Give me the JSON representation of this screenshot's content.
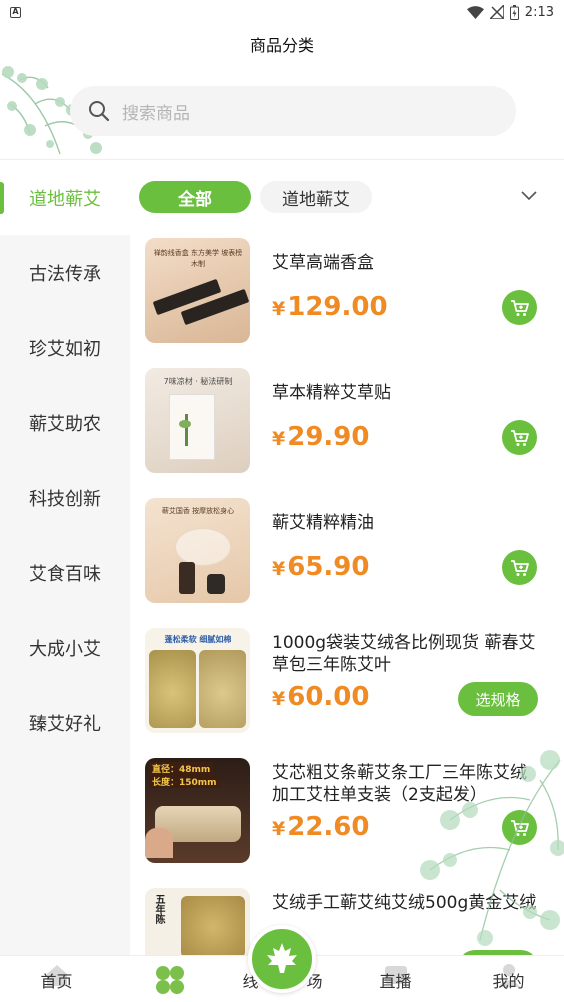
{
  "status_bar": {
    "time": "2:13"
  },
  "title": "商品分类",
  "search": {
    "placeholder": "搜索商品"
  },
  "categories": [
    {
      "label": "道地蕲艾",
      "active": true
    },
    {
      "label": "古法传承"
    },
    {
      "label": "珍艾如初"
    },
    {
      "label": "蕲艾助农"
    },
    {
      "label": "科技创新"
    },
    {
      "label": "艾食百味"
    },
    {
      "label": "大成小艾"
    },
    {
      "label": "臻艾好礼"
    }
  ],
  "filters": {
    "all": "全部",
    "sub": "道地蕲艾"
  },
  "currency": "¥",
  "products": [
    {
      "name": "艾草高端香盒",
      "price": "129.00",
      "action": "cart",
      "thumb_text": "禅韵线香盒 东方美学 坡表榜木制"
    },
    {
      "name": "草本精粹艾草贴",
      "price": "29.90",
      "action": "cart",
      "thumb_text": "7味凉材 · 秘法研制"
    },
    {
      "name": "蕲艾精粹精油",
      "price": "65.90",
      "action": "cart",
      "thumb_text": "蕲艾国香 按摩放松身心"
    },
    {
      "name": "1000g袋装艾绒各比例现货 蕲春艾草包三年陈艾叶",
      "price": "60.00",
      "action": "spec",
      "action_label": "选规格",
      "thumb_text": "蓬松柔软 细腻如棉"
    },
    {
      "name": "艾芯粗艾条蕲艾条工厂三年陈艾绒加工艾柱单支装（2支起发）",
      "price": "22.60",
      "action": "cart",
      "thumb_text": [
        "直径：48mm",
        "长度：150mm"
      ]
    },
    {
      "name": "艾绒手工蕲艾纯艾绒500g黄金艾绒",
      "price": "",
      "action": "spec",
      "thumb_text": "五年陈"
    }
  ],
  "bottom_nav": {
    "home": "首页",
    "category": "",
    "live_partial": "线",
    "live_suffix": "场",
    "broadcast": "直播",
    "mine": "我的"
  },
  "colors": {
    "accent": "#6bbf3e",
    "price": "#f08a23"
  }
}
